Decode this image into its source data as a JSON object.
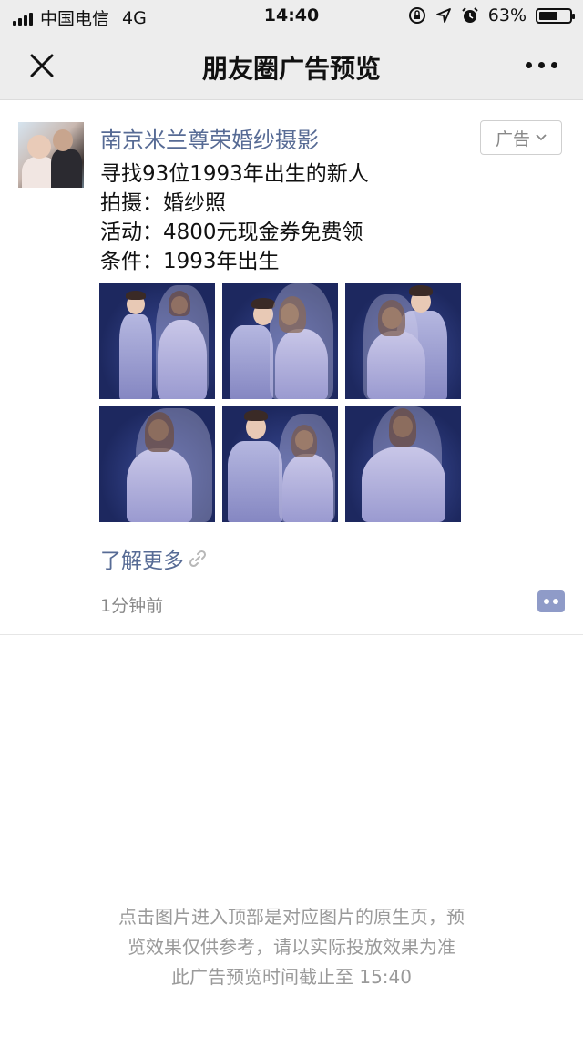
{
  "status_bar": {
    "carrier": "中国电信",
    "network": "4G",
    "time": "14:40",
    "battery": "63%",
    "battery_level": 0.63
  },
  "nav": {
    "title": "朋友圈广告预览"
  },
  "ad": {
    "advertiser": "南京米兰尊荣婚纱摄影",
    "tag_label": "广告",
    "text_lines": [
      "寻找93位1993年出生的新人",
      "拍摄：婚纱照",
      "活动：4800元现金券免费领",
      "条件：1993年出生"
    ],
    "photo_count": 6,
    "learn_more": "了解更多",
    "time_ago": "1分钟前"
  },
  "footer": {
    "lines": [
      "点击图片进入顶部是对应图片的原生页，预",
      "览效果仅供参考，请以实际投放效果为准",
      "此广告预览时间截止至 15:40"
    ]
  },
  "colors": {
    "link": "#576b95",
    "bar_bg": "#ededed",
    "photo_bg": "#1f2a63"
  }
}
